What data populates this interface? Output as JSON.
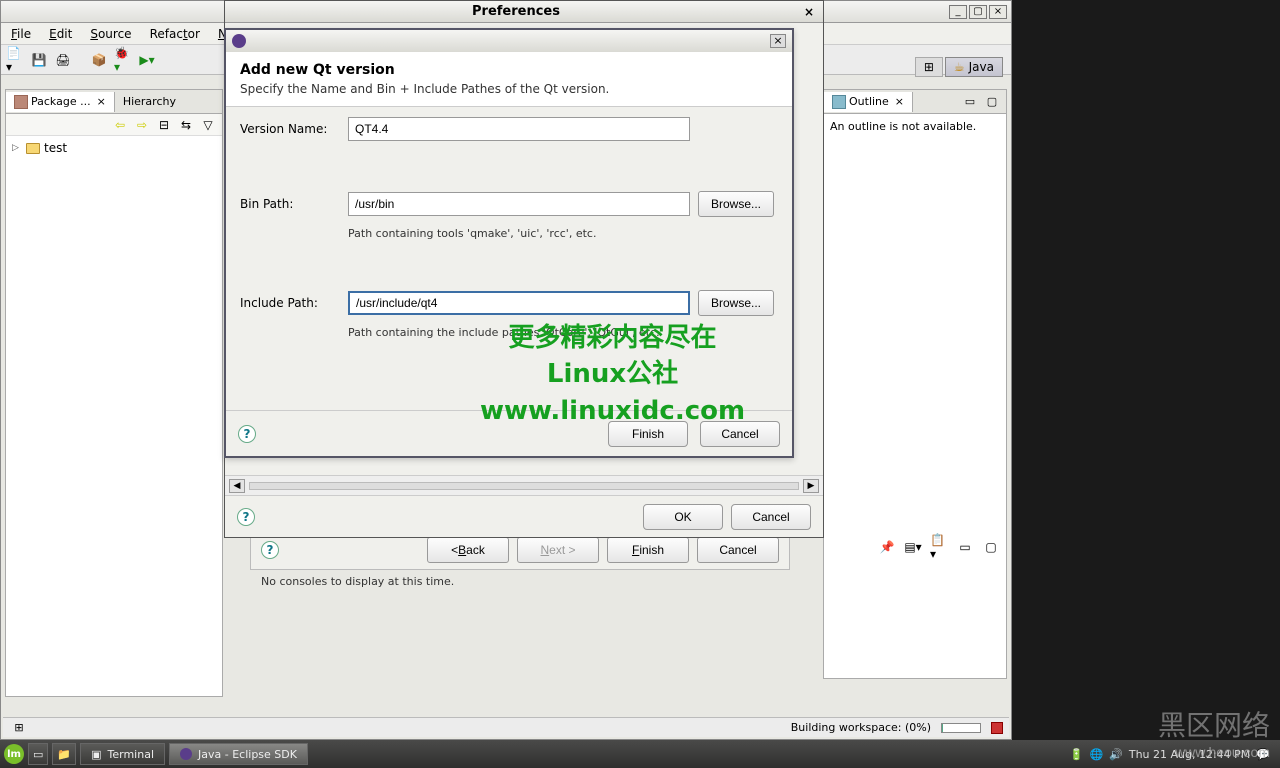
{
  "eclipse": {
    "menubar": [
      "File",
      "Edit",
      "Source",
      "Refactor",
      "Nav"
    ],
    "package_tab": "Package ...",
    "hierarchy_tab": "Hierarchy",
    "tree_item": "test",
    "perspective": "Java",
    "status": "Building workspace: (0%)",
    "console_msg": "No consoles to display at this time."
  },
  "outline": {
    "title": "Outline",
    "empty_msg": "An outline is not available."
  },
  "preferences": {
    "title": "Preferences",
    "ok": "OK",
    "cancel": "Cancel"
  },
  "qt_dialog": {
    "heading": "Add new Qt version",
    "subheading": "Specify the Name and Bin + Include Pathes of the Qt version.",
    "labels": {
      "version": "Version Name:",
      "bin": "Bin Path:",
      "include": "Include Path:"
    },
    "values": {
      "version": "QT4.4",
      "bin": "/usr/bin",
      "include": "/usr/include/qt4"
    },
    "help": {
      "bin": "Path containing tools 'qmake', 'uic', 'rcc', etc.",
      "include": "Path containing the include pathes 'QtCore', 'QtGui', etc."
    },
    "browse": "Browse...",
    "finish": "Finish",
    "cancel": "Cancel"
  },
  "wizard": {
    "back": "< Back",
    "next": "Next >",
    "finish": "Finish",
    "cancel": "Cancel"
  },
  "watermark": {
    "l1": "更多精彩内容尽在",
    "l2": "Linux公社",
    "l3": "www.linuxidc.com"
  },
  "bottom_wm": {
    "big": "黑区网络",
    "small": "www.heou.com"
  },
  "taskbar": {
    "item1": "Terminal",
    "item2": "Java - Eclipse SDK",
    "clock": "Thu 21 Aug, 12:44 PM"
  }
}
